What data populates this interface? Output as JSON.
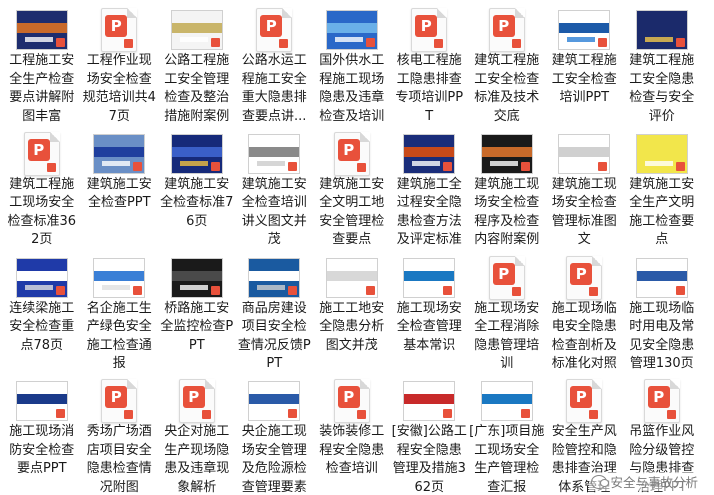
{
  "items": [
    {
      "label": "工程施工安全生产检查要点讲解附图丰富",
      "thumb": "photo",
      "colors": [
        "#1e2d6e",
        "#c96a2a",
        "#ffffff"
      ]
    },
    {
      "label": "工程作业现场安全检查规范培训共47页",
      "thumb": "ppt"
    },
    {
      "label": "公路工程施工安全管理检查及整治措施附案例",
      "thumb": "photo",
      "colors": [
        "#f4f4f4",
        "#c9b56a",
        "#ffffff"
      ]
    },
    {
      "label": "公路水运工程施工安全重大隐患排查要点讲...",
      "thumb": "ppt"
    },
    {
      "label": "国外供水工程施工现场隐患及违章检查及培训",
      "thumb": "photo",
      "colors": [
        "#2a68c8",
        "#6ab0e8",
        "#ffffff"
      ]
    },
    {
      "label": "核电工程施工隐患排查专项培训PPT",
      "thumb": "ppt"
    },
    {
      "label": "建筑工程施工安全检查标准及技术交底",
      "thumb": "ppt"
    },
    {
      "label": "建筑工程施工安全检查培训PPT",
      "thumb": "photo",
      "colors": [
        "#ffffff",
        "#1c5aa8",
        "#2c7fd6"
      ]
    },
    {
      "label": "建筑工程施工安全隐患检查与安全评价",
      "thumb": "photo",
      "colors": [
        "#1b2a6b",
        "#1b2a6b",
        "#f2c84b"
      ]
    },
    {
      "label": "建筑工程施工现场安全检查标准362页",
      "thumb": "ppt"
    },
    {
      "label": "建筑施工安全检查PPT",
      "thumb": "photo",
      "colors": [
        "#6a8fc6",
        "#1f3f9e",
        "#ffffff"
      ]
    },
    {
      "label": "建筑施工安全检查标准76页",
      "thumb": "photo",
      "colors": [
        "#162a7a",
        "#3a5fc8",
        "#f0c040"
      ]
    },
    {
      "label": "建筑施工安全检查培训讲义图文并茂",
      "thumb": "photo",
      "colors": [
        "#ffffff",
        "#8a8a8a",
        "#cccccc"
      ]
    },
    {
      "label": "建筑施工安全文明工地安全管理检查要点",
      "thumb": "ppt"
    },
    {
      "label": "建筑施工全过程安全隐患检查方法及评定标准",
      "thumb": "photo",
      "colors": [
        "#1a2d7a",
        "#c84a1a",
        "#ffffff"
      ]
    },
    {
      "label": "建筑施工现场安全检查程序及检查内容附案例",
      "thumb": "photo",
      "colors": [
        "#1a1a1a",
        "#c86a2a",
        "#ffffff"
      ]
    },
    {
      "label": "建筑施工现场安全检查管理标准图文",
      "thumb": "photo",
      "colors": [
        "#ffffff",
        "#d0d0d0",
        "#ffffff"
      ]
    },
    {
      "label": "建筑施工安全生产文明施工检查要点",
      "thumb": "photo",
      "colors": [
        "#f2e64b",
        "#f2e64b",
        "#ffffff"
      ]
    },
    {
      "label": "连续梁施工安全检查重点78页",
      "thumb": "photo",
      "colors": [
        "#1f3aa8",
        "#ffffff",
        "#e0e0e0"
      ]
    },
    {
      "label": "名企施工生产绿色安全施工检查通报",
      "thumb": "photo",
      "colors": [
        "#ffffff",
        "#3a7fd6",
        "#e0e0e0"
      ]
    },
    {
      "label": "桥路施工安全监控检查PPT",
      "thumb": "photo",
      "colors": [
        "#1a1a1a",
        "#4a4a4a",
        "#ffffff"
      ]
    },
    {
      "label": "商品房建设项目安全检查情况反馈PPT",
      "thumb": "photo",
      "colors": [
        "#1a5aa0",
        "#ffffff",
        "#d0d0d0"
      ]
    },
    {
      "label": "施工工地安全隐患分析图文并茂",
      "thumb": "photo",
      "colors": [
        "#ffffff",
        "#d8d8d8",
        "#ffffff"
      ]
    },
    {
      "label": "施工现场安全检查管理基本常识",
      "thumb": "photo",
      "colors": [
        "#ffffff",
        "#1a78c2",
        "#ffffff"
      ]
    },
    {
      "label": "施工现场安全工程消除隐患管理培训",
      "thumb": "ppt"
    },
    {
      "label": "施工现场临电安全隐患检查剖析及标准化对照",
      "thumb": "ppt"
    },
    {
      "label": "施工现场临时用电及常见安全隐患管理130页",
      "thumb": "photo",
      "colors": [
        "#ffffff",
        "#2a5aa8",
        "#ffffff"
      ]
    },
    {
      "label": "施工现场消防安全检查要点PPT",
      "thumb": "photo",
      "colors": [
        "#ffffff",
        "#1a3a8a",
        "#ffffff"
      ]
    },
    {
      "label": "秀场广场酒店项目安全隐患检查情况附图",
      "thumb": "ppt"
    },
    {
      "label": "央企对施工生产现场隐患及违章现象解析",
      "thumb": "ppt"
    },
    {
      "label": "央企施工现场安全管理及危险源检查管理要素",
      "thumb": "photo",
      "colors": [
        "#ffffff",
        "#2a5aa8",
        "#ffffff"
      ]
    },
    {
      "label": "装饰装修工程安全隐患检查培训",
      "thumb": "ppt"
    },
    {
      "label": "[安徽]公路工程安全隐患管理及措施362页",
      "thumb": "photo",
      "colors": [
        "#ffffff",
        "#c82a2a",
        "#ffffff"
      ]
    },
    {
      "label": "[广东]项目施工现场安全生产管理检查汇报",
      "thumb": "photo",
      "colors": [
        "#ffffff",
        "#1a78c2",
        "#ffffff"
      ]
    },
    {
      "label": "安全生产风险管控和隐患排查治理体系管理",
      "thumb": "ppt"
    },
    {
      "label": "吊篮作业风险分级管控与隐患排查治理PPT",
      "thumb": "ppt"
    }
  ],
  "ppt_glyph": "P",
  "watermark": {
    "text": "安全与事故分析"
  }
}
